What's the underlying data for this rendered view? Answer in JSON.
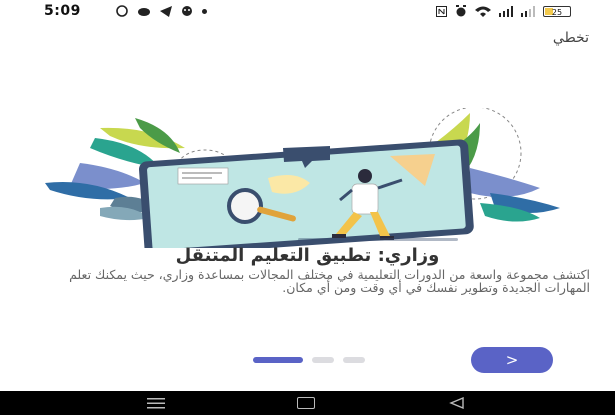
{
  "status_bar": {
    "time": "5:09",
    "battery_level": "25",
    "left_icons": [
      "whatsapp-icon",
      "cloud-icon",
      "telegram-icon",
      "face-icon",
      "dot-icon"
    ],
    "right_icons": [
      "nfc-icon",
      "alarm-icon",
      "wifi-icon",
      "signal-icon",
      "signal-icon",
      "battery-icon"
    ]
  },
  "skip_label": "تخطي",
  "onboarding": {
    "title": "وزاري: تطبيق التعليم المتنقل",
    "description": "اكتشف مجموعة واسعة من الدورات التعليمية في مختلف المجالات بمساعدة وزاري، حيث يمكنك تعلم المهارات الجديدة وتطوير نفسك في أي وقت ومن أي مكان.",
    "pages_total": 3,
    "current_page": 1
  },
  "next_label": ">",
  "nav_bar": {
    "icons": [
      "menu-icon",
      "home-icon",
      "back-icon"
    ]
  },
  "colors": {
    "accent": "#5a63c6",
    "inactive_dot": "#dcdce0"
  }
}
